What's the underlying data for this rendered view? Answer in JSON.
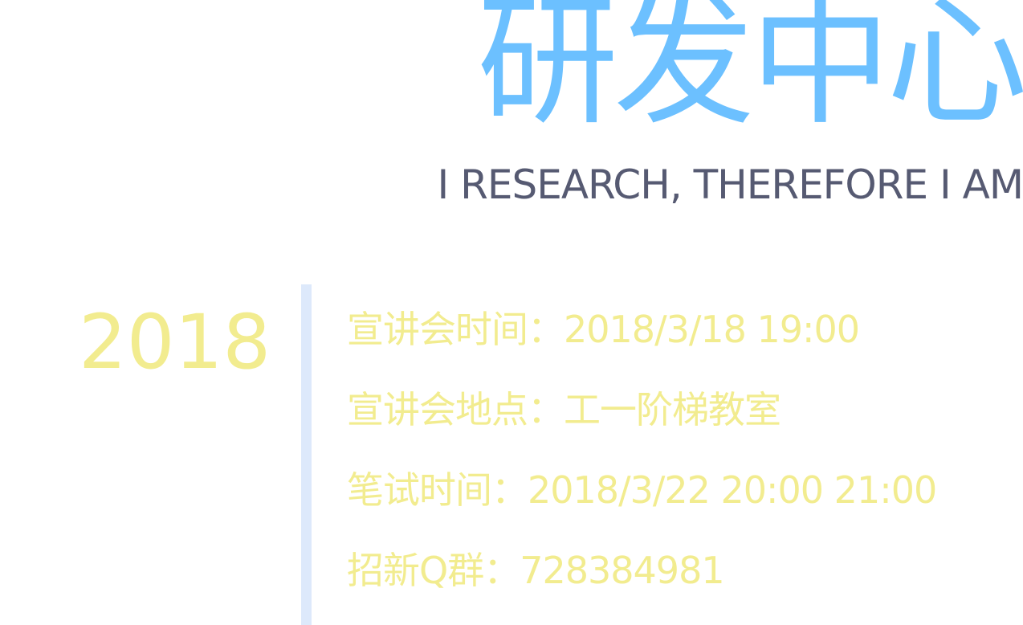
{
  "header": {
    "title": "研发中心",
    "subtitle": "I RESEARCH, THEREFORE I AM"
  },
  "event": {
    "year": "2018",
    "details": [
      "宣讲会时间：2018/3/18 19:00",
      "宣讲会地点：工一阶梯教室",
      "笔试时间：2018/3/22 20:00 21:00",
      "招新Q群：728384981"
    ]
  },
  "colors": {
    "title": "#6cc0ff",
    "subtitle": "#565a72",
    "accent_text": "#f2ec8f",
    "divider": "#dde9fb",
    "background": "#ffffff"
  }
}
